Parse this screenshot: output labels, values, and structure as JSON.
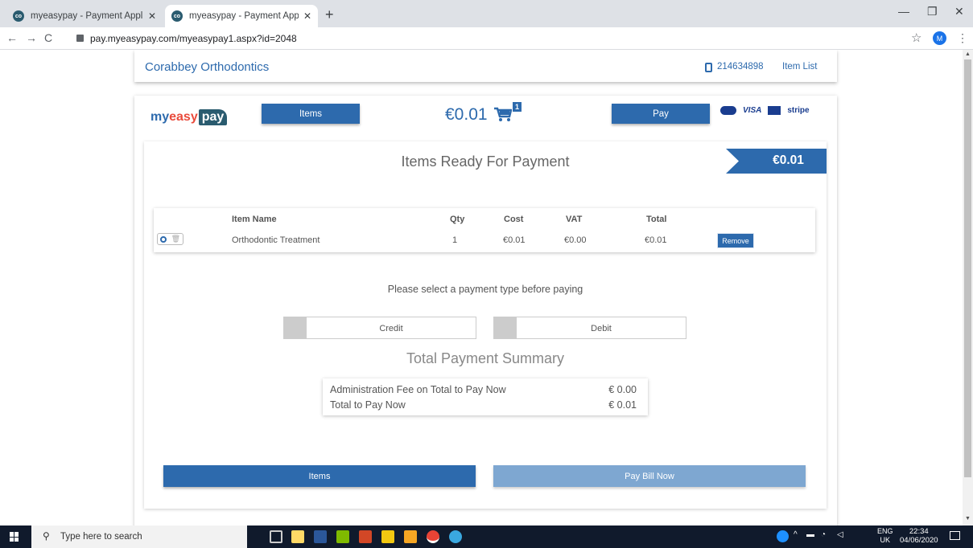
{
  "browser": {
    "tabs": [
      {
        "title": "myeasypay - Payment Applicatio"
      },
      {
        "title": "myeasypay - Payment Applicatio"
      }
    ],
    "url": "pay.myeasypay.com/myeasypay1.aspx?id=2048",
    "profile_initial": "M"
  },
  "header": {
    "brand": "Corabbey Orthodontics",
    "phone": "214634898",
    "item_list_link": "Item List"
  },
  "payment_bar": {
    "logo_my": "my",
    "logo_easy": "easy",
    "logo_pay": "pay",
    "items_button": "Items",
    "cart_total": "€0.01",
    "cart_count": "1",
    "pay_button": "Pay",
    "card_brands": [
      "VISA",
      "stripe"
    ]
  },
  "ready": {
    "title": "Items Ready For Payment",
    "total_ribbon": "€0.01"
  },
  "table": {
    "headers": {
      "name": "Item Name",
      "qty": "Qty",
      "cost": "Cost",
      "vat": "VAT",
      "total": "Total"
    },
    "rows": [
      {
        "name": "Orthodontic Treatment",
        "qty": "1",
        "cost": "€0.01",
        "vat": "€0.00",
        "total": "€0.01",
        "action": "Remove"
      }
    ]
  },
  "payment_type": {
    "message": "Please select a payment type before paying",
    "options": [
      "Credit",
      "Debit"
    ]
  },
  "summary": {
    "title": "Total Payment Summary",
    "rows": [
      {
        "label": "Administration Fee on Total to Pay Now",
        "value": "€ 0.00"
      },
      {
        "label": "Total to Pay Now",
        "value": "€ 0.01"
      }
    ]
  },
  "footer_buttons": {
    "items": "Items",
    "pay_bill": "Pay Bill Now"
  },
  "taskbar": {
    "search_placeholder": "Type here to search",
    "lang_top": "ENG",
    "lang_bottom": "UK",
    "time": "22:34",
    "date": "04/06/2020"
  },
  "colors": {
    "primary": "#2d6aad",
    "primary_light": "#7ea7d1",
    "taskbar": "#101a2c"
  }
}
